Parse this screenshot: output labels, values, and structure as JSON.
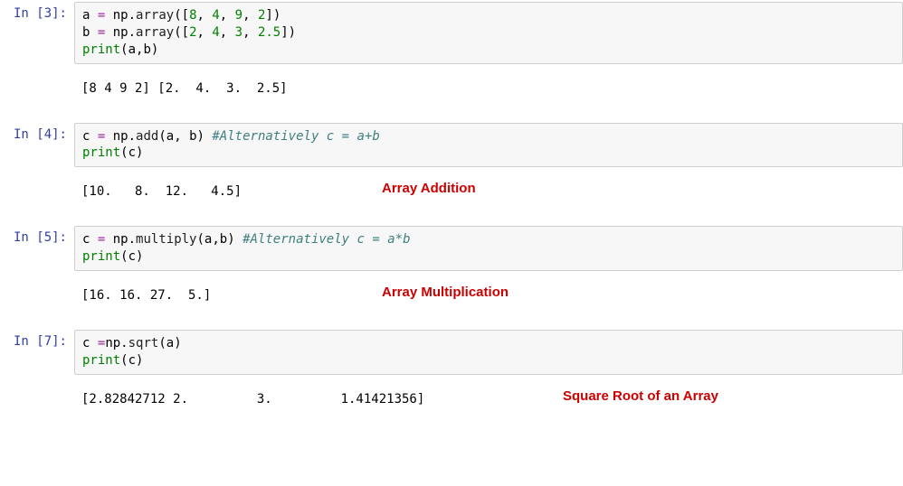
{
  "cells": [
    {
      "prompt": "In [3]:",
      "code": {
        "line1": {
          "a": "a",
          "eq": "=",
          "np": "np",
          "dot": ".",
          "fn": "array",
          "op": "([",
          "n1": "8",
          "c1": ", ",
          "n2": "4",
          "c2": ", ",
          "n3": "9",
          "c3": ", ",
          "n4": "2",
          "cl": "])"
        },
        "line2": {
          "b": "b",
          "eq": "=",
          "np": "np",
          "dot": ".",
          "fn": "array",
          "op": "([",
          "n1": "2",
          "c1": ", ",
          "n2": "4",
          "c2": ", ",
          "n3": "3",
          "c3": ", ",
          "n4": "2.5",
          "cl": "])"
        },
        "line3": {
          "fn": "print",
          "op": "(",
          "args": "a,b",
          "cl": ")"
        }
      },
      "output": "[8 4 9 2] [2.  4.  3.  2.5]"
    },
    {
      "prompt": "In [4]:",
      "code": {
        "line1": {
          "c": "c",
          "eq": "=",
          "np": "np",
          "dot": ".",
          "fn": "add",
          "op": "(",
          "args": "a, b",
          "cl": ")",
          "sp": " ",
          "comment": "#Alternatively c = a+b"
        },
        "line2": {
          "fn": "print",
          "op": "(",
          "args": "c",
          "cl": ")"
        }
      },
      "output": "[10.   8.  12.   4.5]",
      "annotation": "Array Addition"
    },
    {
      "prompt": "In [5]:",
      "code": {
        "line1": {
          "c": "c",
          "eq": "=",
          "np": "np",
          "dot": ".",
          "fn": "multiply",
          "op": "(",
          "args": "a,b",
          "cl": ")",
          "sp": " ",
          "comment": "#Alternatively c = a*b"
        },
        "line2": {
          "fn": "print",
          "op": "(",
          "args": "c",
          "cl": ")"
        }
      },
      "output": "[16. 16. 27.  5.]",
      "annotation": "Array Multiplication"
    },
    {
      "prompt": "In [7]:",
      "code": {
        "line1": {
          "c": "c",
          "sp": " ",
          "eq": "=",
          "np": "np",
          "dot": ".",
          "fn": "sqrt",
          "op": "(",
          "args": "a",
          "cl": ")"
        },
        "line2": {
          "fn": "print",
          "op": "(",
          "args": "c",
          "cl": ")"
        }
      },
      "output": "[2.82842712 2.         3.         1.41421356]",
      "annotation": "Square Root of an Array"
    }
  ]
}
